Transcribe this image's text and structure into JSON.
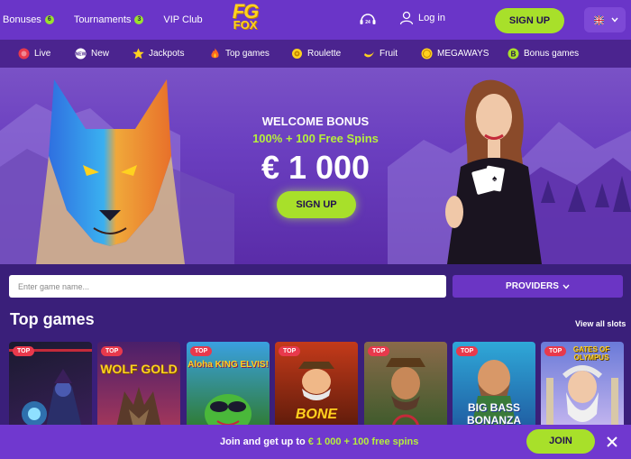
{
  "header": {
    "nav": [
      {
        "label": "Bonuses",
        "badge": "6"
      },
      {
        "label": "Tournaments",
        "badge": "3"
      },
      {
        "label": "VIP Club"
      }
    ],
    "logo_line1": "FG",
    "logo_line2": "FOX",
    "support_badge": "24",
    "login_label": "Log in",
    "signup_label": "SIGN UP",
    "language_icon": "uk-flag-icon"
  },
  "categories": [
    {
      "label": "Live",
      "icon": "live-icon",
      "color": "#e8394c"
    },
    {
      "label": "New",
      "icon": "new-icon",
      "color": "#ffffff"
    },
    {
      "label": "Jackpots",
      "icon": "star-icon",
      "color": "#ffd21f"
    },
    {
      "label": "Top games",
      "icon": "flame-icon",
      "color": "#ff6a1f"
    },
    {
      "label": "Roulette",
      "icon": "roulette-icon",
      "color": "#ffd21f"
    },
    {
      "label": "Fruit",
      "icon": "banana-icon",
      "color": "#ffd21f"
    },
    {
      "label": "MEGAWAYS",
      "icon": "coin-icon",
      "color": "#ffd21f"
    },
    {
      "label": "Bonus games",
      "icon": "bonus-b-icon",
      "color": "#a8e02a"
    }
  ],
  "hero": {
    "title": "WELCOME BONUS",
    "subtitle": "100% + 100 Free Spins",
    "amount": "€ 1 000",
    "cta": "SIGN UP"
  },
  "search": {
    "placeholder": "Enter game name...",
    "providers_label": "PROVIDERS"
  },
  "top_games": {
    "title": "Top games",
    "view_all": "View all slots",
    "tag": "TOP",
    "games": [
      {
        "title": "",
        "bg1": "#1a1a2e",
        "bg2": "#3a1f5a"
      },
      {
        "title": "WOLF GOLD",
        "bg1": "#4a1f6a",
        "bg2": "#a8385a"
      },
      {
        "title": "Aloha KING ELVIS!",
        "bg1": "#3aa0e0",
        "bg2": "#2f7a2a"
      },
      {
        "title": "BONE",
        "bg1": "#c43a1a",
        "bg2": "#5a1a0a"
      },
      {
        "title": "",
        "bg1": "#7a5a3a",
        "bg2": "#3a5a2a"
      },
      {
        "title": "BIG BASS BONANZA",
        "bg1": "#2fa8d8",
        "bg2": "#1f5aa0"
      },
      {
        "title": "GATES OF OLYMPUS",
        "bg1": "#6a7ad8",
        "bg2": "#c8b8f0"
      }
    ]
  },
  "bottom_bar": {
    "text_prefix": "Join and get up to ",
    "text_highlight": "€ 1 000 + 100 free spins",
    "join_label": "JOIN"
  },
  "colors": {
    "accent": "#a8e02a",
    "header_bg": "#6a35c8",
    "category_bg": "#4b248f",
    "tag_red": "#e8394c"
  }
}
